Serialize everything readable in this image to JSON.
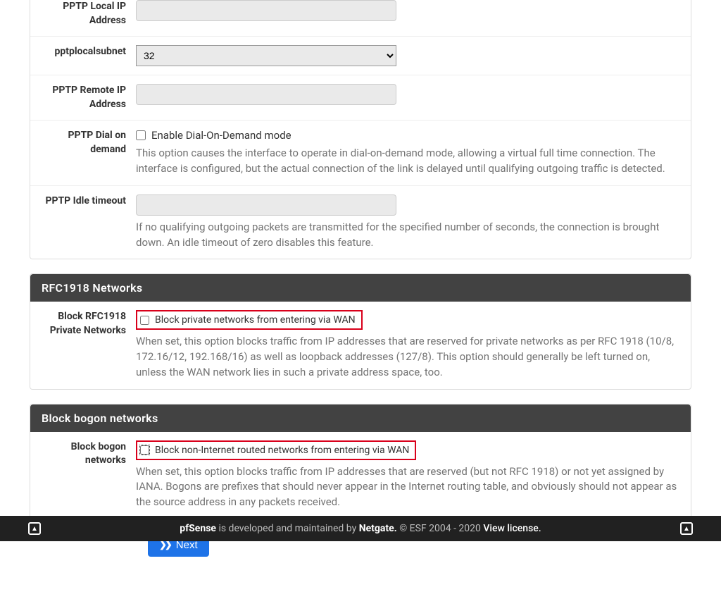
{
  "pptp": {
    "local_ip_label": "PPTP Local IP Address",
    "local_ip_value": "",
    "localsubnet_label": "pptplocalsubnet",
    "localsubnet_value": "32",
    "remote_ip_label": "PPTP Remote IP Address",
    "remote_ip_value": "",
    "dial_label": "PPTP Dial on demand",
    "dial_check_label": "Enable Dial-On-Demand mode",
    "dial_help": "This option causes the interface to operate in dial-on-demand mode, allowing a virtual full time connection. The interface is configured, but the actual connection of the link is delayed until qualifying outgoing traffic is detected.",
    "idle_label": "PPTP Idle timeout",
    "idle_value": "",
    "idle_help": "If no qualifying outgoing packets are transmitted for the specified number of seconds, the connection is brought down. An idle timeout of zero disables this feature."
  },
  "rfc1918": {
    "heading": "RFC1918 Networks",
    "row_label": "Block RFC1918 Private Networks",
    "check_label": "Block private networks from entering via WAN",
    "help": "When set, this option blocks traffic from IP addresses that are reserved for private networks as per RFC 1918 (10/8, 172.16/12, 192.168/16) as well as loopback addresses (127/8). This option should generally be left turned on, unless the WAN network lies in such a private address space, too."
  },
  "bogon": {
    "heading": "Block bogon networks",
    "row_label": "Block bogon networks",
    "check_label": "Block non-Internet routed networks from entering via WAN",
    "help": "When set, this option blocks traffic from IP addresses that are reserved (but not RFC 1918) or not yet assigned by IANA. Bogons are prefixes that should never appear in the Internet routing table, and obviously should not appear as the source address in any packets received."
  },
  "next_button": "Next",
  "footer": {
    "product": "pfSense",
    "mid": " is developed and maintained by ",
    "company": "Netgate.",
    "copyright": " © ESF 2004 - 2020 ",
    "license": "View license."
  }
}
